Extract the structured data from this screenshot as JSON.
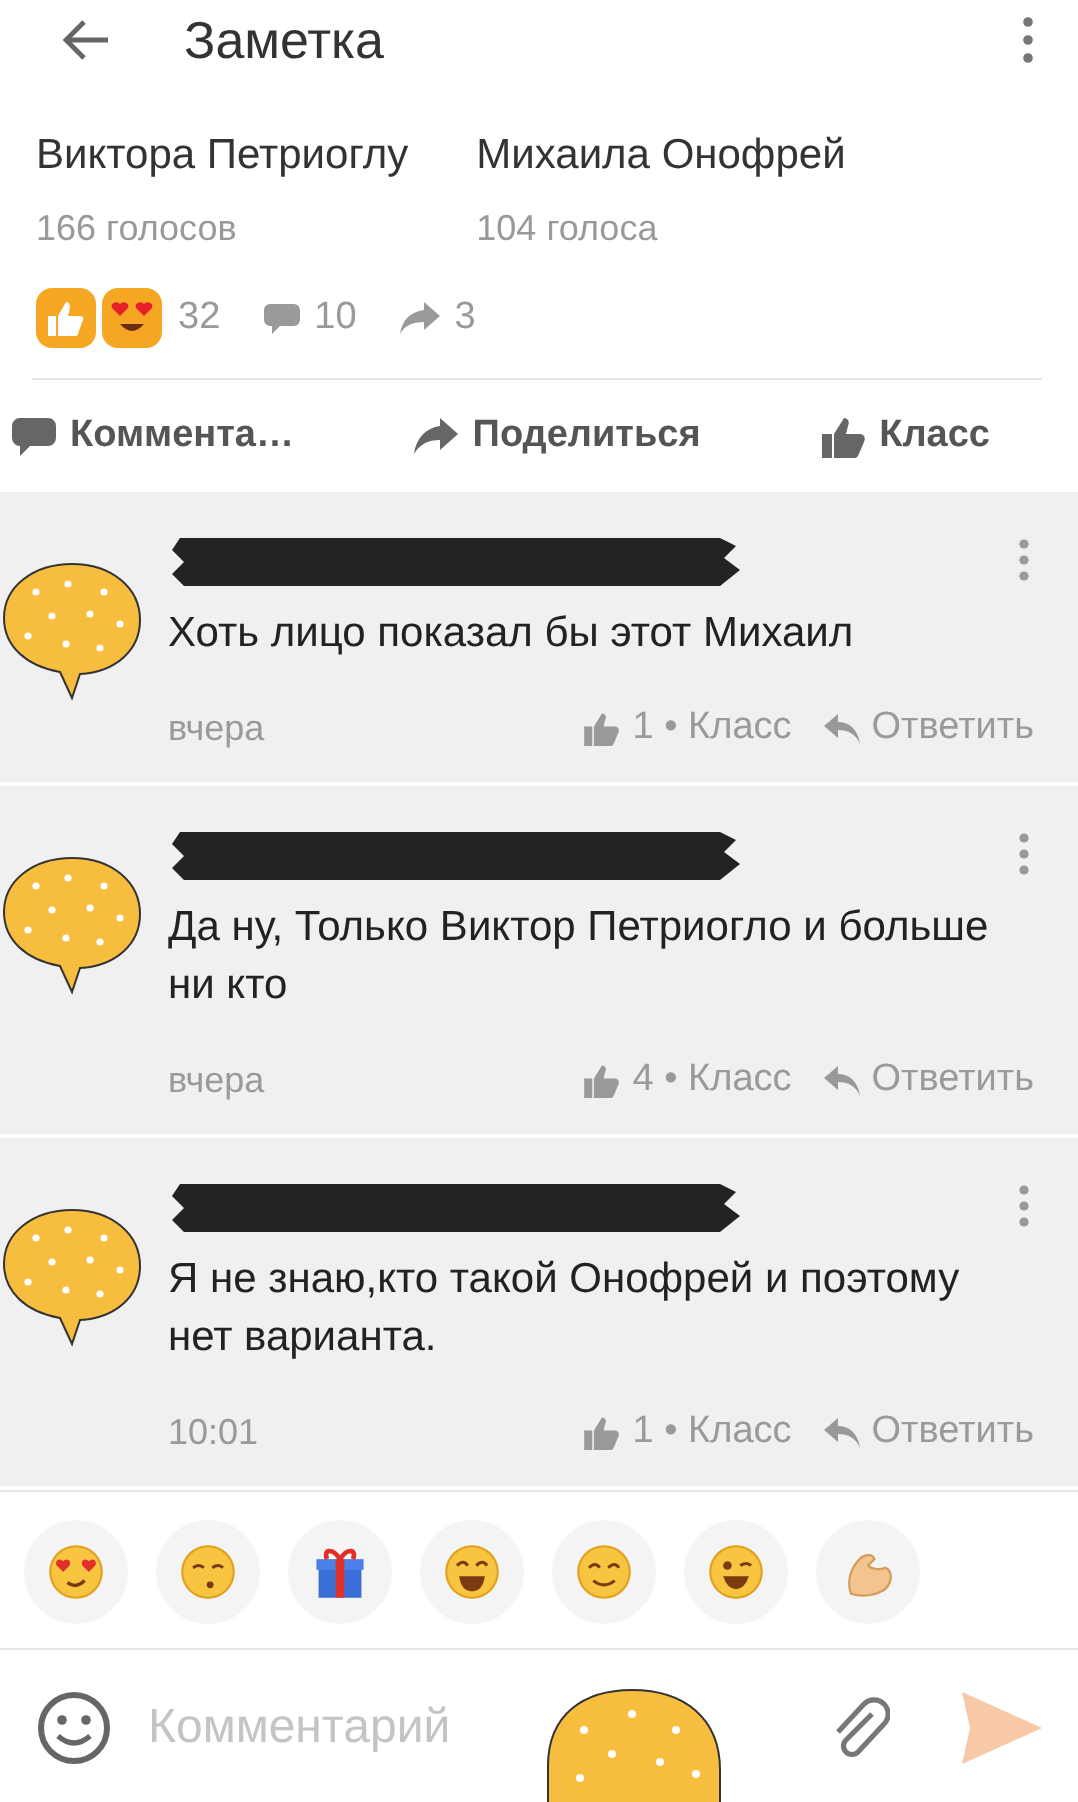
{
  "app_bar": {
    "title": "Заметка"
  },
  "poll_options": [
    {
      "name": "Виктора Петриоглу",
      "votes": "166 голосов"
    },
    {
      "name": "Михаила Онофрей",
      "votes": "104 голоса"
    }
  ],
  "stats": {
    "reactions": "32",
    "comments": "10",
    "shares": "3"
  },
  "actions": [
    {
      "kind": "comment",
      "label": "Коммента…"
    },
    {
      "kind": "share",
      "label": "Поделиться"
    },
    {
      "kind": "like",
      "label": "Класс"
    }
  ],
  "comments": [
    {
      "text": "Хоть лицо показал бы этот Михаил",
      "time": "вчера",
      "likes": "1 • Класс",
      "reply": "Ответить"
    },
    {
      "text": "Да ну, Только Виктор Петриогло и больше ни кто",
      "time": "вчера",
      "likes": "4 • Класс",
      "reply": "Ответить"
    },
    {
      "text": "Я не знаю,кто такой Онофрей и поэтому нет варианта.",
      "time": "10:01",
      "likes": "1 • Класс",
      "reply": "Ответить"
    }
  ],
  "stickers": [
    {
      "kind": "heart-eyes"
    },
    {
      "kind": "kiss"
    },
    {
      "kind": "gift"
    },
    {
      "kind": "laugh"
    },
    {
      "kind": "smile"
    },
    {
      "kind": "grin"
    },
    {
      "kind": "muscle"
    }
  ],
  "composer": {
    "placeholder": "Комментарий"
  }
}
